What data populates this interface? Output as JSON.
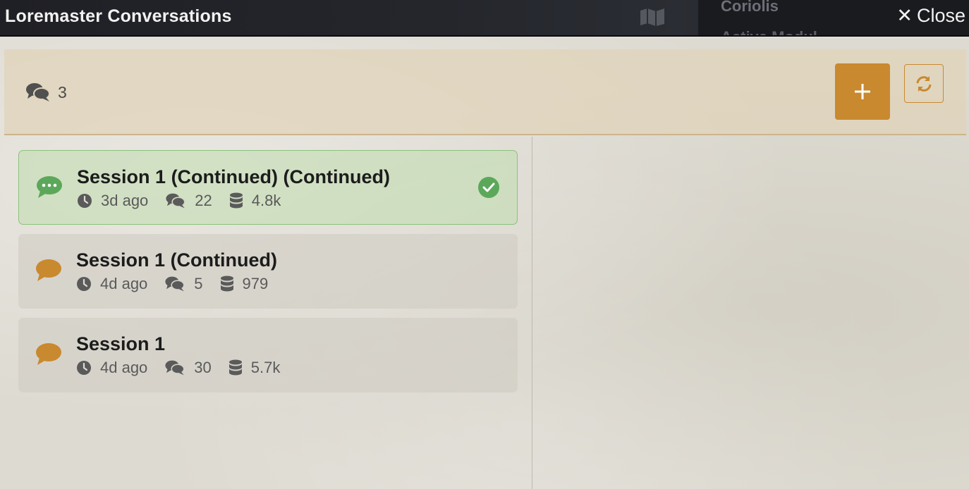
{
  "window": {
    "title": "Loremaster Conversations",
    "close_label": "Close",
    "background_labels": [
      "Coriolis",
      "Active Modul"
    ]
  },
  "header": {
    "conversation_count": "3"
  },
  "conversations": [
    {
      "name": "Session 1 (Continued) (Continued)",
      "time": "3d ago",
      "messages": "22",
      "tokens": "4.8k",
      "active": true
    },
    {
      "name": "Session 1 (Continued)",
      "time": "4d ago",
      "messages": "5",
      "tokens": "979",
      "active": false
    },
    {
      "name": "Session 1",
      "time": "4d ago",
      "messages": "30",
      "tokens": "5.7k",
      "active": false
    }
  ],
  "colors": {
    "accent": "#c9892f",
    "active_green": "#5ba85a",
    "active_bg": "#bfdcad"
  },
  "icons": {
    "close": "close-icon",
    "count": "comments-icon",
    "new": "plus-icon",
    "refresh": "refresh-icon",
    "active_chat": "chat-dots-icon",
    "chat": "chat-bubble-icon",
    "time": "clock-icon",
    "messages": "comments-icon",
    "tokens": "database-icon",
    "check": "check-circle-icon"
  }
}
